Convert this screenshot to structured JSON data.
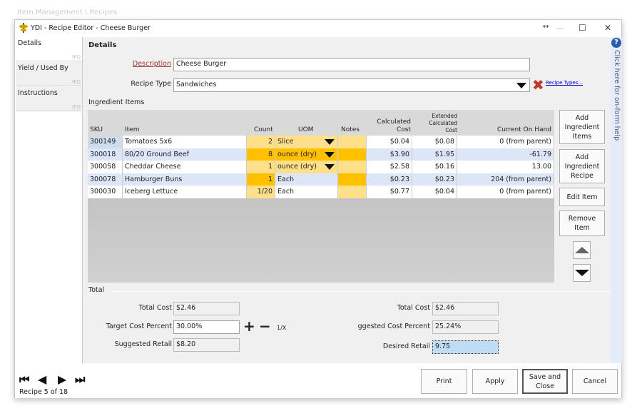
{
  "background_title": "Item Management \\ Recipes",
  "window": {
    "title": "YDI - Recipe Editor - Cheese Burger",
    "controls": {
      "resize": "↔",
      "minimize": "—",
      "maximize": "☐",
      "close": "✕"
    }
  },
  "tabs": [
    {
      "label": "Details",
      "key": "(F1)"
    },
    {
      "label": "Yield / Used By",
      "key": "(F2)"
    },
    {
      "label": "Instructions",
      "key": "(F3)"
    }
  ],
  "section_title": "Details",
  "form": {
    "description_label": "Description",
    "description_value": "Cheese Burger",
    "recipe_type_label": "Recipe Type",
    "recipe_type_value": "Sandwiches",
    "recipe_types_link": "Recipe Types..."
  },
  "ingredients": {
    "label": "Ingredient Items",
    "columns": [
      "SKU",
      "Item",
      "Count",
      "UOM",
      "Notes",
      "Calculated Cost",
      "Extended Calculated Cost",
      "Current On Hand"
    ],
    "rows": [
      {
        "sku": "300149",
        "item": "Tomatoes 5x6",
        "count": "2",
        "uom": "Slice",
        "notes": "",
        "calc": "$0.04",
        "ext": "$0.08",
        "onhand": "0 (from parent)"
      },
      {
        "sku": "300018",
        "item": "80/20 Ground Beef",
        "count": "8",
        "uom": "ounce (dry)",
        "notes": "",
        "calc": "$3.90",
        "ext": "$1.95",
        "onhand": "-61.79"
      },
      {
        "sku": "300058",
        "item": "Cheddar Cheese",
        "count": "1",
        "uom": "ounce (dry)",
        "notes": "",
        "calc": "$2.58",
        "ext": "$0.16",
        "onhand": "13.00"
      },
      {
        "sku": "300078",
        "item": "Hamburger Buns",
        "count": "1",
        "uom": "Each",
        "notes": "",
        "calc": "$0.23",
        "ext": "$0.23",
        "onhand": "204 (from parent)"
      },
      {
        "sku": "300030",
        "item": "Iceberg Lettuce",
        "count": "1/20",
        "uom": "Each",
        "notes": "",
        "calc": "$0.77",
        "ext": "$0.04",
        "onhand": "0 (from parent)"
      }
    ]
  },
  "side_buttons": {
    "add_items": "Add Ingredient Items",
    "add_recipe": "Add Ingredient Recipe",
    "edit": "Edit Item",
    "remove": "Remove Item"
  },
  "totals": {
    "label": "Total",
    "total_cost_label": "Total Cost",
    "total_cost": "$2.46",
    "target_label": "Target Cost Percent",
    "target": "30.00%",
    "inverse": "1/X",
    "suggested_retail_label": "Suggested Retail",
    "suggested_retail": "$8.20",
    "total_cost2_label": "Total Cost",
    "total_cost2": "$2.46",
    "suggested_pct_label": "Suggested Cost Percent",
    "suggested_pct": "25.24%",
    "desired_label": "Desired Retail",
    "desired": "9.75"
  },
  "help_text": "Click here for on-form help",
  "footer": {
    "record": "Recipe 5 of 18",
    "print": "Print",
    "apply": "Apply",
    "save_close": "Save and Close",
    "cancel": "Cancel"
  },
  "colors": {
    "row_alt": "#dce6f7",
    "count_light": "#ffe08a",
    "count_dark": "#ffc000",
    "accent_red": "#c0392b",
    "link": "#0000cc"
  }
}
